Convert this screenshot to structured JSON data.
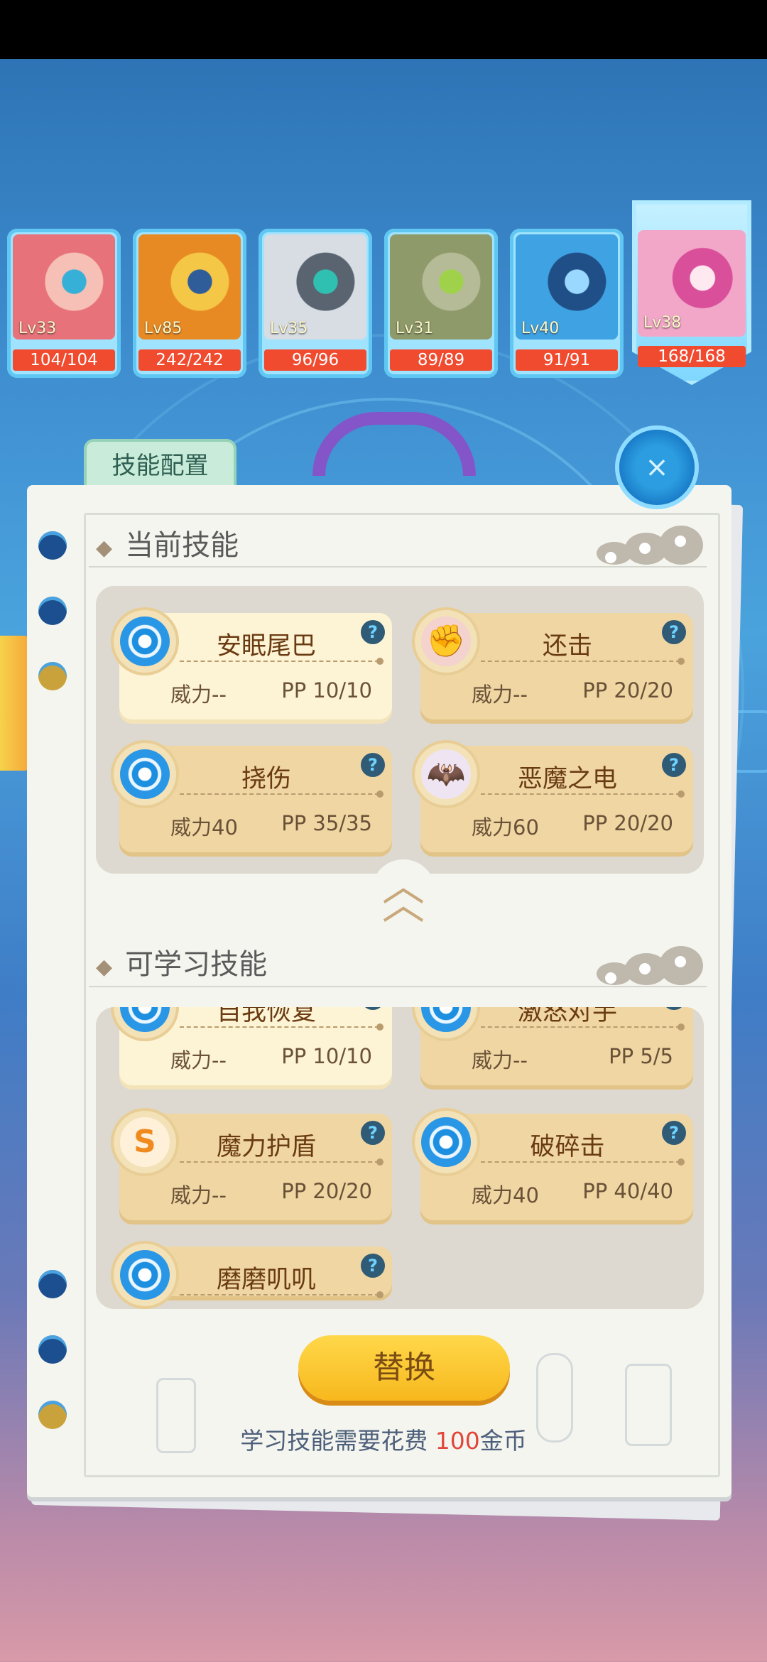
{
  "roster": [
    {
      "level": "Lv33",
      "hp": "104/104",
      "hp_fraction": 1.0,
      "palette": [
        "#e7727a",
        "#f6c0b6",
        "#36b0d6"
      ]
    },
    {
      "level": "Lv85",
      "hp": "242/242",
      "hp_fraction": 1.0,
      "palette": [
        "#e88a24",
        "#f5c746",
        "#2f5d9a"
      ]
    },
    {
      "level": "Lv35",
      "hp": "96/96",
      "hp_fraction": 1.0,
      "palette": [
        "#d8dde4",
        "#5a6470",
        "#2fc0b2"
      ]
    },
    {
      "level": "Lv31",
      "hp": "89/89",
      "hp_fraction": 1.0,
      "palette": [
        "#8e9a6a",
        "#b4bb96",
        "#9fd24a"
      ]
    },
    {
      "level": "Lv40",
      "hp": "91/91",
      "hp_fraction": 1.0,
      "palette": [
        "#3fa2e2",
        "#1f4f86",
        "#9ad8ff"
      ]
    },
    {
      "level": "Lv38",
      "hp": "168/168",
      "hp_fraction": 1.0,
      "palette": [
        "#f2a7c9",
        "#d94f9a",
        "#ffe9f1"
      ]
    }
  ],
  "panel": {
    "tab_label": "技能配置",
    "close_icon": "×"
  },
  "current": {
    "title": "当前技能",
    "skills": [
      {
        "name": "安眠尾巴",
        "power": "威力--",
        "pp": "PP 10/10",
        "icon": "blue-ring",
        "highlight": true
      },
      {
        "name": "还击",
        "power": "威力--",
        "pp": "PP 20/20",
        "icon": "fist"
      },
      {
        "name": "挠伤",
        "power": "威力40",
        "pp": "PP 35/35",
        "icon": "blue-ring"
      },
      {
        "name": "恶魔之电",
        "power": "威力60",
        "pp": "PP 20/20",
        "icon": "bat"
      }
    ]
  },
  "learnable": {
    "title": "可学习技能",
    "skills": [
      {
        "name": "自我恢复",
        "power": "威力--",
        "pp": "PP 10/10",
        "icon": "blue-ring",
        "highlight": true
      },
      {
        "name": "激怒对手",
        "power": "威力--",
        "pp": "PP 5/5",
        "icon": "blue-ring"
      },
      {
        "name": "魔力护盾",
        "power": "威力--",
        "pp": "PP 20/20",
        "icon": "swirl"
      },
      {
        "name": "破碎击",
        "power": "威力40",
        "pp": "PP 40/40",
        "icon": "blue-ring"
      },
      {
        "name": "磨磨叽叽",
        "power": "",
        "pp": "",
        "icon": "blue-ring"
      }
    ]
  },
  "actions": {
    "replace_label": "替换",
    "cost_prefix": "学习技能需要花费 ",
    "cost_amount": "100",
    "cost_suffix": "金币"
  },
  "colors": {
    "hp_bar": "#cf2a1e",
    "card": "#efd6a3",
    "card_highlight": "#fdf3d5",
    "button": "#f7b81d",
    "cost_amount": "#e2453a"
  }
}
